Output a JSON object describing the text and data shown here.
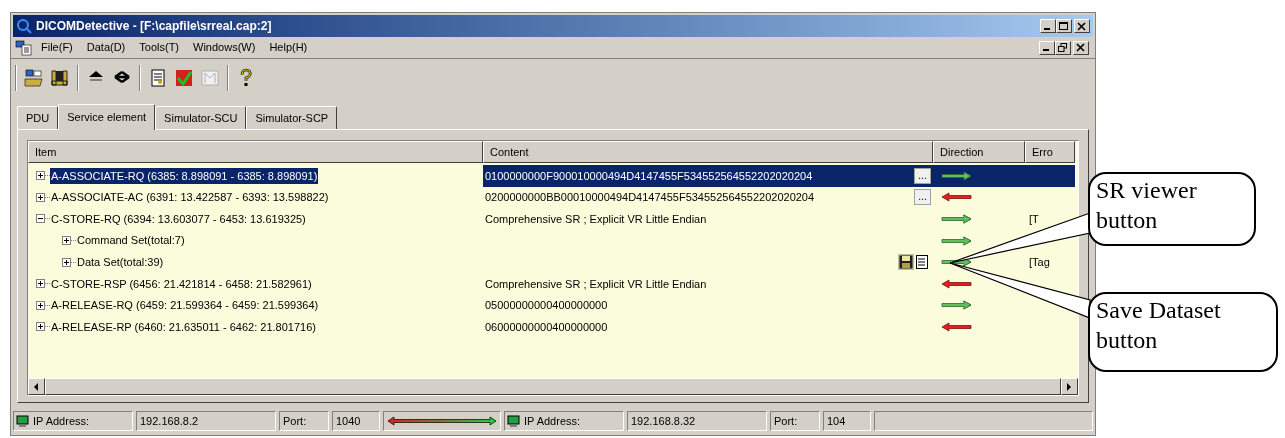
{
  "window": {
    "title": "DICOMDetective - [F:\\capfile\\srreal.cap:2]"
  },
  "menu": [
    "File(F)",
    "Data(D)",
    "Tools(T)",
    "Windows(W)",
    "Help(H)"
  ],
  "toolbar": [
    {
      "kind": "sep"
    },
    {
      "kind": "open"
    },
    {
      "kind": "capture"
    },
    {
      "kind": "sep"
    },
    {
      "kind": "up"
    },
    {
      "kind": "down"
    },
    {
      "kind": "sep"
    },
    {
      "kind": "note"
    },
    {
      "kind": "dt"
    },
    {
      "kind": "disabled"
    },
    {
      "kind": "sep"
    },
    {
      "kind": "help"
    }
  ],
  "tabs": [
    {
      "label": "PDU",
      "selected": false
    },
    {
      "label": "Service element",
      "selected": true
    },
    {
      "label": "Simulator-SCU",
      "selected": false
    },
    {
      "label": "Simulator-SCP",
      "selected": false
    }
  ],
  "table": {
    "columns": [
      "Item",
      "Content",
      "Direction",
      "Erro"
    ],
    "rows": [
      {
        "item": "A-ASSOCIATE-RQ (6385: 8.898091 - 6385: 8.898091)",
        "content": "0100000000F900010000494D4147455F534552564552202020204",
        "detail_button": "...",
        "outgoing": true,
        "selected": true,
        "expanded": false
      },
      {
        "item": "A-ASSOCIATE-AC (6391: 13.422587 - 6393: 13.598822)",
        "content": "0200000000BB00010000494D4147455F534552564552202020204",
        "detail_button": "...",
        "outgoing": false,
        "selected": false,
        "expanded": false
      },
      {
        "item": "C-STORE-RQ (6394: 13.603077 - 6453: 13.619325)",
        "content": "Comprehensive SR ; Explicit VR Little Endian",
        "outgoing": true,
        "error": "[T",
        "selected": false,
        "expanded": true,
        "children": [
          {
            "item": "Command Set(total:7)",
            "outgoing": true,
            "selected": false,
            "expanded": false
          },
          {
            "item": "Data Set(total:39)",
            "dataset_buttons": true,
            "outgoing": true,
            "error": "[Tag",
            "selected": false,
            "expanded": false
          }
        ]
      },
      {
        "item": "C-STORE-RSP (6456: 21.421814 - 6458: 21.582961)",
        "content": "Comprehensive SR ; Explicit VR Little Endian",
        "outgoing": false,
        "selected": false,
        "expanded": false
      },
      {
        "item": "A-RELEASE-RQ (6459: 21.599364 - 6459: 21.599364)",
        "content": "05000000000400000000",
        "outgoing": true,
        "selected": false,
        "expanded": false
      },
      {
        "item": "A-RELEASE-RP (6460: 21.635011 - 6462: 21.801716)",
        "content": "06000000000400000000",
        "outgoing": false,
        "selected": false,
        "expanded": false
      }
    ]
  },
  "status_bar": {
    "local": {
      "ip_label": "IP Address:",
      "ip": "192.168.8.2",
      "port_label": "Port:",
      "port": "1040"
    },
    "remote": {
      "ip_label": "IP Address:",
      "ip": "192.168.8.32",
      "port_label": "Port:",
      "port": "104"
    }
  },
  "callouts": [
    {
      "text": "SR viewer button"
    },
    {
      "text": "Save Dataset button"
    }
  ]
}
